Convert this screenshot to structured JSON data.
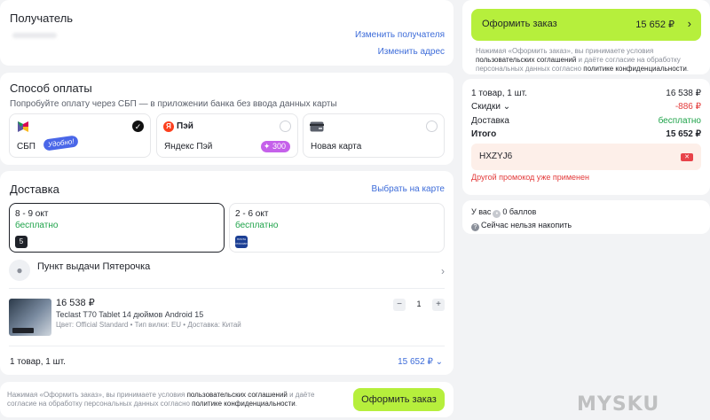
{
  "recipient": {
    "title": "Получатель",
    "change_recipient": "Изменить получателя",
    "change_address": "Изменить адрес"
  },
  "payment": {
    "title": "Способ оплаты",
    "hint": "Попробуйте оплату через СБП — в приложении банка без ввода данных карты",
    "options": [
      {
        "label": "СБП",
        "badge": "Удобно!",
        "selected": true,
        "icon": "sbp-icon"
      },
      {
        "label": "Яндекс Пэй",
        "logo_text": "Пэй",
        "badge": "300",
        "selected": false,
        "icon": "yandex-pay-icon"
      },
      {
        "label": "Новая карта",
        "selected": false,
        "icon": "card-icon"
      }
    ]
  },
  "delivery": {
    "title": "Доставка",
    "choose_on_map": "Выбрать на карте",
    "options": [
      {
        "dates": "8 - 9 окт",
        "price": "бесплатно",
        "selected": true,
        "carrier_logo": "5"
      },
      {
        "dates": "2 - 6 окт",
        "price": "бесплатно",
        "selected": false,
        "carrier_logo": "ПОЧТА РОССИИ"
      }
    ],
    "pickup_point": "Пункт выдачи Пятерочка",
    "product": {
      "price": "16 538 ₽",
      "name": "Teclast T70 Tablet 14 дюймов Android 15",
      "meta": "Цвет: Official Standard • Тип вилки: EU • Доставка: Китай",
      "quantity": "1",
      "minus": "−",
      "plus": "+"
    },
    "summary_count": "1 товар, 1 шт.",
    "summary_price": "15 652 ₽"
  },
  "bottom_bar": {
    "legal_prefix": "Нажимая «Оформить заказ», вы принимаете условия ",
    "legal_link1": "пользовательских соглашений",
    "legal_mid": " и даёте согласие на обработку персональных данных согласно ",
    "legal_link2": "политике конфиденциальности",
    "legal_suffix": ".",
    "button": "Оформить заказ"
  },
  "checkout": {
    "button": "Оформить заказ",
    "total": "15 652 ₽",
    "legal_prefix": "Нажимая «Оформить заказ», вы принимаете условия ",
    "legal_link1": "пользовательских соглашений",
    "legal_mid": " и даёте согласие на обработку персональных данных согласно ",
    "legal_link2": "политике конфиденциальности",
    "legal_suffix": "."
  },
  "totals": {
    "items_label": "1 товар, 1 шт.",
    "items_value": "16 538 ₽",
    "discount_label": "Скидки",
    "discount_value": "-886 ₽",
    "delivery_label": "Доставка",
    "delivery_value": "бесплатно",
    "total_label": "Итого",
    "total_value": "15 652 ₽",
    "promo_code": "HXZYJ6",
    "promo_error": "Другой промокод уже применен"
  },
  "bonus": {
    "balance": "У вас",
    "balance_value": "0 баллов",
    "cannot_earn": "Сейчас нельзя накопить"
  },
  "colors": {
    "accent_green": "#b6ef3c",
    "link_blue": "#3d6cd9",
    "error_red": "#e33a3a",
    "free_green": "#1fa34a"
  },
  "watermark": "MYSKU"
}
